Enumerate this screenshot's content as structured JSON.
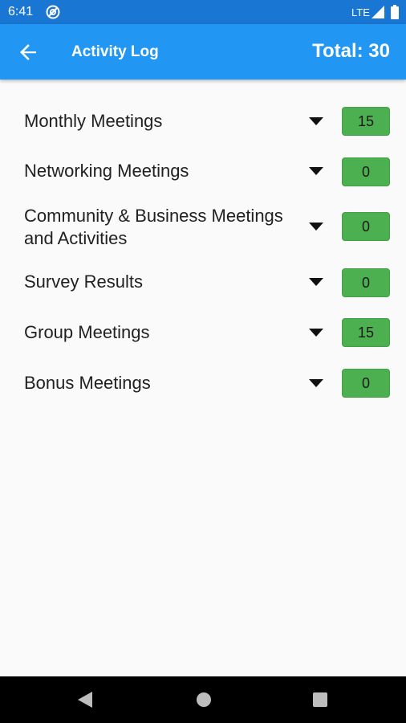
{
  "status_bar": {
    "time": "6:41",
    "network": "LTE",
    "app_icon": "at-sign-icon",
    "signal_icon": "signal-icon",
    "battery_icon": "battery-icon"
  },
  "app_bar": {
    "back_icon": "arrow-back-icon",
    "title": "Activity Log",
    "total": "Total: 30",
    "color": "#2196f3"
  },
  "activities": [
    {
      "label": "Monthly Meetings",
      "count": "15"
    },
    {
      "label": "Networking Meetings",
      "count": "0"
    },
    {
      "label": "Community & Business Meetings and Activities",
      "count": "0"
    },
    {
      "label": "Survey Results",
      "count": "0"
    },
    {
      "label": "Group Meetings",
      "count": "15"
    },
    {
      "label": "Bonus Meetings",
      "count": "0"
    }
  ],
  "badge_color": "#4caf50",
  "nav_bar": {
    "back_icon": "nav-back-icon",
    "home_icon": "nav-home-icon",
    "recents_icon": "nav-recents-icon"
  }
}
